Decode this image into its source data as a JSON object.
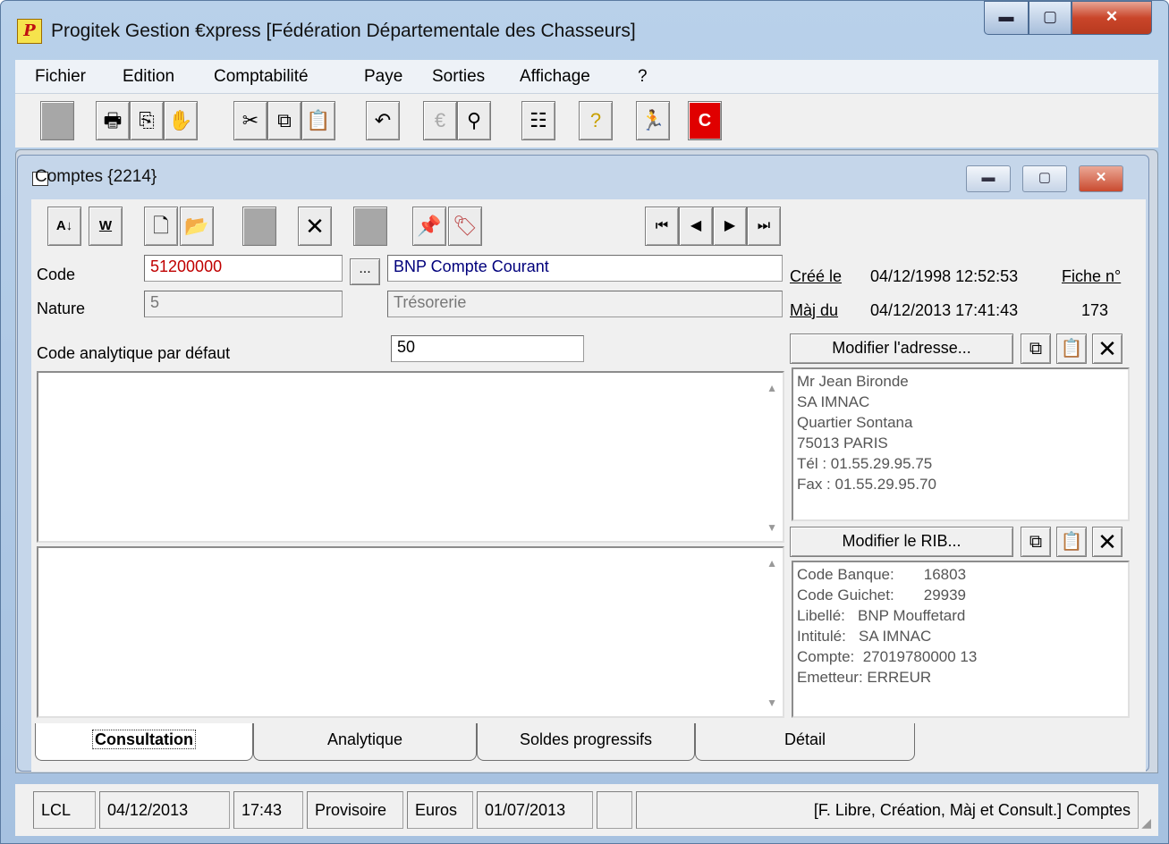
{
  "window": {
    "title": "Progitek Gestion €xpress [Fédération Départementale des Chasseurs]",
    "controls": {
      "minimize": "▬",
      "maximize": "▢",
      "close": "✕"
    }
  },
  "menu": [
    "Fichier",
    "Edition",
    "Comptabilité",
    "Paye",
    "Sorties",
    "Affichage",
    "?"
  ],
  "toolbar": {
    "icons": [
      "blank-icon",
      "printer-icon",
      "export-icon",
      "hand-icon",
      "cut-icon",
      "copy-icon",
      "paste-icon",
      "undo-icon",
      "euro-icon",
      "binoculars-icon",
      "properties-icon",
      "help-icon",
      "exit-icon",
      "c-icon"
    ],
    "c_label": "C"
  },
  "child": {
    "title": "Comptes {2214}",
    "controls": {
      "minimize": "▬",
      "maximize": "▢",
      "close": "✕"
    }
  },
  "record_toolbar": {
    "sort_label": "A↓",
    "w_label": "W",
    "nav": [
      "⏮",
      "◀",
      "▶",
      "⏭"
    ]
  },
  "form": {
    "code_label": "Code",
    "code_value": "51200000",
    "lookup_button": "...",
    "code_desc": "BNP Compte Courant",
    "nature_label": "Nature",
    "nature_value": "5",
    "nature_desc": "Trésorerie",
    "created_label": "Créé le",
    "created_value": "04/12/1998 12:52:53",
    "fiche_label": "Fiche n°",
    "updated_label": "Màj du",
    "updated_value": "04/12/2013 17:41:43",
    "fiche_value": "173",
    "analytic_label": "Code analytique par défaut",
    "analytic_value": "50"
  },
  "address": {
    "button": "Modifier l'adresse...",
    "lines": [
      "Mr Jean Bironde",
      "SA IMNAC",
      "Quartier Sontana",
      "75013 PARIS",
      "Tél : 01.55.29.95.75",
      "Fax : 01.55.29.95.70"
    ]
  },
  "rib": {
    "button": "Modifier le RIB...",
    "lines": [
      "Code Banque:       16803",
      "Code Guichet:       29939",
      "Libellé:   BNP Mouffetard",
      "Intitulé:   SA IMNAC",
      "Compte:  27019780000 13",
      "Emetteur: ERREUR"
    ]
  },
  "tabs": [
    "Consultation",
    "Analytique",
    "Soldes progressifs",
    "Détail"
  ],
  "status": [
    "LCL",
    "04/12/2013",
    "17:43",
    "Provisoire",
    "Euros",
    "01/07/2013",
    "",
    "[F. Libre, Création, Màj et Consult.] Comptes"
  ]
}
